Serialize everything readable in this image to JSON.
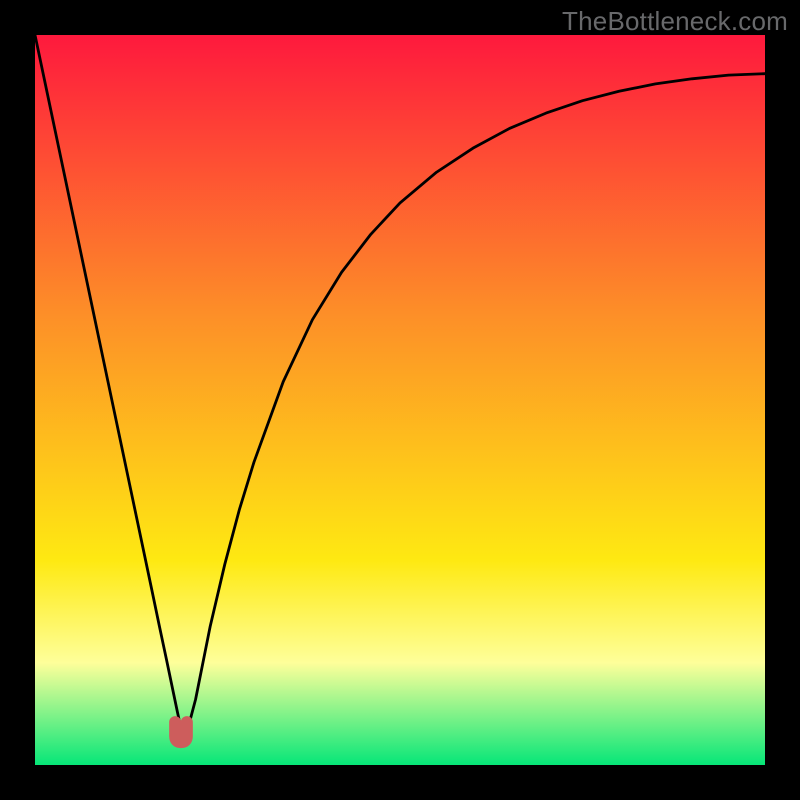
{
  "attribution": "TheBottleneck.com",
  "colors": {
    "frame": "#000000",
    "gradient_top": "#fe193d",
    "gradient_mid1": "#fd8e28",
    "gradient_mid2": "#fee912",
    "gradient_paleband": "#feff9a",
    "gradient_bottom": "#06e678",
    "curve": "#000000",
    "marker": "#cd5d5c",
    "attribution_text": "#68696b"
  },
  "chart_data": {
    "type": "line",
    "title": "",
    "xlabel": "",
    "ylabel": "",
    "xlim": [
      0,
      100
    ],
    "ylim": [
      0,
      100
    ],
    "x": [
      0,
      2,
      4,
      6,
      8,
      10,
      12,
      14,
      16,
      17,
      18,
      19,
      19.5,
      20,
      20.5,
      21,
      22,
      23,
      24,
      26,
      28,
      30,
      34,
      38,
      42,
      46,
      50,
      55,
      60,
      65,
      70,
      75,
      80,
      85,
      90,
      95,
      100
    ],
    "y": [
      100,
      90.5,
      81,
      71.5,
      62,
      52.5,
      43,
      33.5,
      24,
      19.2,
      14.5,
      9.7,
      7.3,
      5,
      5,
      5.2,
      9,
      14,
      19,
      27.5,
      35,
      41.5,
      52.5,
      61,
      67.5,
      72.7,
      77,
      81.2,
      84.5,
      87.2,
      89.3,
      91,
      92.3,
      93.3,
      94,
      94.5,
      94.7
    ],
    "minimum": {
      "x": 20,
      "y": 5
    },
    "marker_points": [
      {
        "x": 19.2,
        "y": 4.5
      },
      {
        "x": 20.8,
        "y": 4.5
      }
    ],
    "annotation": ""
  }
}
